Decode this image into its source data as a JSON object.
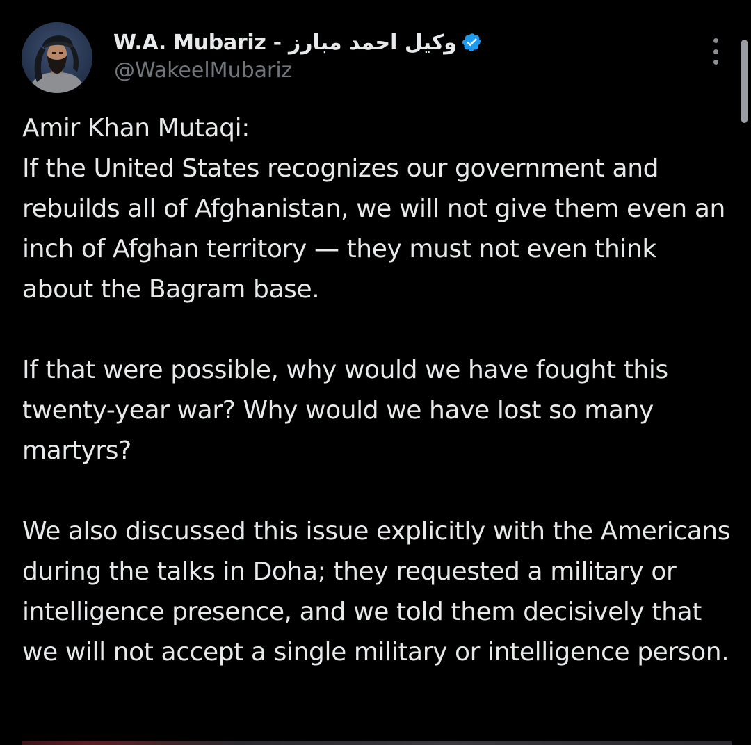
{
  "header": {
    "display_name": "W.A. Mubariz - وکیل احمد مبارز",
    "handle": "@WakeelMubariz",
    "verified": true,
    "verified_color": "#1d9bf0",
    "avatar_icon": "profile-photo",
    "more_icon": "more-vertical-icon"
  },
  "tweet": {
    "paragraphs": [
      "Amir Khan Mutaqi:\nIf the United States recognizes our government and rebuilds all of Afghanistan, we will not give them even an inch of Afghan territory — they must not even think about the Bagram base.",
      "If that were possible, why would we have fought this twenty-year war? Why would we have lost so many martyrs?",
      "We also discussed this issue explicitly with the Americans during the talks in Doha; they requested a military or intelligence presence, and we told them decisively that we will not accept a single military or intelligence person."
    ]
  },
  "colors": {
    "background": "#000000",
    "text": "#e7e9ea",
    "secondary_text": "#71767b"
  }
}
